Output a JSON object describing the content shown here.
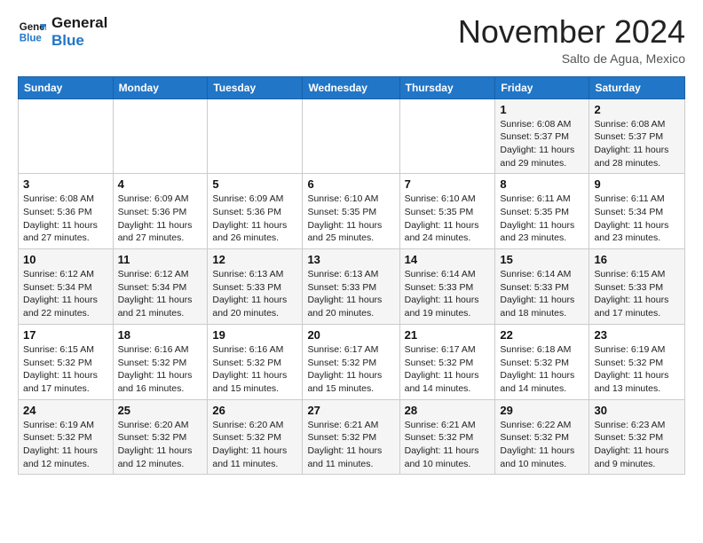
{
  "header": {
    "logo_line1": "General",
    "logo_line2": "Blue",
    "month": "November 2024",
    "location": "Salto de Agua, Mexico"
  },
  "weekdays": [
    "Sunday",
    "Monday",
    "Tuesday",
    "Wednesday",
    "Thursday",
    "Friday",
    "Saturday"
  ],
  "weeks": [
    [
      {
        "day": "",
        "info": ""
      },
      {
        "day": "",
        "info": ""
      },
      {
        "day": "",
        "info": ""
      },
      {
        "day": "",
        "info": ""
      },
      {
        "day": "",
        "info": ""
      },
      {
        "day": "1",
        "info": "Sunrise: 6:08 AM\nSunset: 5:37 PM\nDaylight: 11 hours\nand 29 minutes."
      },
      {
        "day": "2",
        "info": "Sunrise: 6:08 AM\nSunset: 5:37 PM\nDaylight: 11 hours\nand 28 minutes."
      }
    ],
    [
      {
        "day": "3",
        "info": "Sunrise: 6:08 AM\nSunset: 5:36 PM\nDaylight: 11 hours\nand 27 minutes."
      },
      {
        "day": "4",
        "info": "Sunrise: 6:09 AM\nSunset: 5:36 PM\nDaylight: 11 hours\nand 27 minutes."
      },
      {
        "day": "5",
        "info": "Sunrise: 6:09 AM\nSunset: 5:36 PM\nDaylight: 11 hours\nand 26 minutes."
      },
      {
        "day": "6",
        "info": "Sunrise: 6:10 AM\nSunset: 5:35 PM\nDaylight: 11 hours\nand 25 minutes."
      },
      {
        "day": "7",
        "info": "Sunrise: 6:10 AM\nSunset: 5:35 PM\nDaylight: 11 hours\nand 24 minutes."
      },
      {
        "day": "8",
        "info": "Sunrise: 6:11 AM\nSunset: 5:35 PM\nDaylight: 11 hours\nand 23 minutes."
      },
      {
        "day": "9",
        "info": "Sunrise: 6:11 AM\nSunset: 5:34 PM\nDaylight: 11 hours\nand 23 minutes."
      }
    ],
    [
      {
        "day": "10",
        "info": "Sunrise: 6:12 AM\nSunset: 5:34 PM\nDaylight: 11 hours\nand 22 minutes."
      },
      {
        "day": "11",
        "info": "Sunrise: 6:12 AM\nSunset: 5:34 PM\nDaylight: 11 hours\nand 21 minutes."
      },
      {
        "day": "12",
        "info": "Sunrise: 6:13 AM\nSunset: 5:33 PM\nDaylight: 11 hours\nand 20 minutes."
      },
      {
        "day": "13",
        "info": "Sunrise: 6:13 AM\nSunset: 5:33 PM\nDaylight: 11 hours\nand 20 minutes."
      },
      {
        "day": "14",
        "info": "Sunrise: 6:14 AM\nSunset: 5:33 PM\nDaylight: 11 hours\nand 19 minutes."
      },
      {
        "day": "15",
        "info": "Sunrise: 6:14 AM\nSunset: 5:33 PM\nDaylight: 11 hours\nand 18 minutes."
      },
      {
        "day": "16",
        "info": "Sunrise: 6:15 AM\nSunset: 5:33 PM\nDaylight: 11 hours\nand 17 minutes."
      }
    ],
    [
      {
        "day": "17",
        "info": "Sunrise: 6:15 AM\nSunset: 5:32 PM\nDaylight: 11 hours\nand 17 minutes."
      },
      {
        "day": "18",
        "info": "Sunrise: 6:16 AM\nSunset: 5:32 PM\nDaylight: 11 hours\nand 16 minutes."
      },
      {
        "day": "19",
        "info": "Sunrise: 6:16 AM\nSunset: 5:32 PM\nDaylight: 11 hours\nand 15 minutes."
      },
      {
        "day": "20",
        "info": "Sunrise: 6:17 AM\nSunset: 5:32 PM\nDaylight: 11 hours\nand 15 minutes."
      },
      {
        "day": "21",
        "info": "Sunrise: 6:17 AM\nSunset: 5:32 PM\nDaylight: 11 hours\nand 14 minutes."
      },
      {
        "day": "22",
        "info": "Sunrise: 6:18 AM\nSunset: 5:32 PM\nDaylight: 11 hours\nand 14 minutes."
      },
      {
        "day": "23",
        "info": "Sunrise: 6:19 AM\nSunset: 5:32 PM\nDaylight: 11 hours\nand 13 minutes."
      }
    ],
    [
      {
        "day": "24",
        "info": "Sunrise: 6:19 AM\nSunset: 5:32 PM\nDaylight: 11 hours\nand 12 minutes."
      },
      {
        "day": "25",
        "info": "Sunrise: 6:20 AM\nSunset: 5:32 PM\nDaylight: 11 hours\nand 12 minutes."
      },
      {
        "day": "26",
        "info": "Sunrise: 6:20 AM\nSunset: 5:32 PM\nDaylight: 11 hours\nand 11 minutes."
      },
      {
        "day": "27",
        "info": "Sunrise: 6:21 AM\nSunset: 5:32 PM\nDaylight: 11 hours\nand 11 minutes."
      },
      {
        "day": "28",
        "info": "Sunrise: 6:21 AM\nSunset: 5:32 PM\nDaylight: 11 hours\nand 10 minutes."
      },
      {
        "day": "29",
        "info": "Sunrise: 6:22 AM\nSunset: 5:32 PM\nDaylight: 11 hours\nand 10 minutes."
      },
      {
        "day": "30",
        "info": "Sunrise: 6:23 AM\nSunset: 5:32 PM\nDaylight: 11 hours\nand 9 minutes."
      }
    ]
  ]
}
